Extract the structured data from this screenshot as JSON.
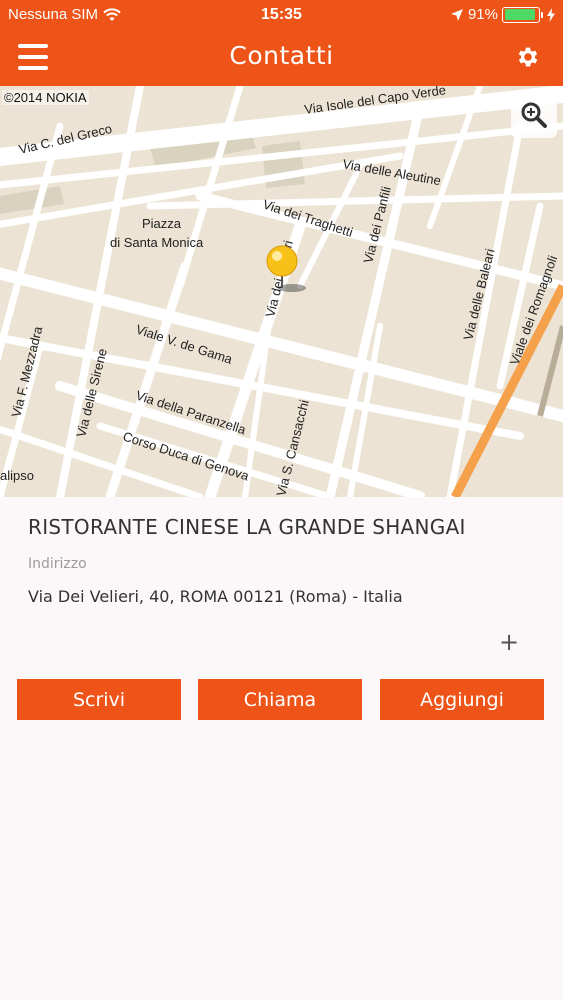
{
  "status_bar": {
    "carrier": "Nessuna SIM",
    "time": "15:35",
    "battery": "91%",
    "battery_level": 0.91,
    "icons": [
      "wifi-icon",
      "location-arrow-icon",
      "battery-icon",
      "charging-bolt-icon"
    ]
  },
  "nav": {
    "title": "Contatti",
    "menu_icon": "hamburger-menu-icon",
    "settings_icon": "gear-icon"
  },
  "map": {
    "copyright": "©2014 NOKIA",
    "zoom_icon": "zoom-in-icon",
    "labels": {
      "via_isole_capo_verde": "Via Isole del Capo Verde",
      "via_c_del_greco": "Via C. del Greco",
      "via_delle_aleutine": "Via delle Aleutine",
      "via_dei_traghetti": "Via dei Traghetti",
      "via_dei_panfili": "Via dei Panfili",
      "piazza_line1": "Piazza",
      "piazza_line2": "di Santa Monica",
      "via_dei_velieri": "Via dei Velieri",
      "via_delle_baleari": "Via delle Baleari",
      "viale_dei_romagnoli": "Viale dei Romagnoli",
      "viale_v_de_gama": "Viale V. de Gama",
      "via_f_mezzadra": "Via F. Mezzadra",
      "via_delle_sirene": "Via delle Sirene",
      "via_della_paranzella": "Via della Paranzella",
      "corso_duca_di_genova": "Corso Duca di Genova",
      "via_s_cansacchi": "Via S. Cansacchi",
      "calipso": "alipso",
      "top_left_fragment": "Via d"
    },
    "pin_color": "#f7c11a"
  },
  "contact": {
    "name": "RISTORANTE CINESE LA GRANDE SHANGAI",
    "address_label": "Indirizzo",
    "address": "Via Dei Velieri, 40, ROMA 00121 (Roma) - Italia",
    "expand_icon": "+"
  },
  "actions": {
    "write": "Scrivi",
    "call": "Chiama",
    "add": "Aggiungi"
  },
  "colors": {
    "brand": "#ee5318",
    "map_bg": "#ece3d4",
    "road": "#ffffff",
    "highway": "#f5a04a"
  }
}
